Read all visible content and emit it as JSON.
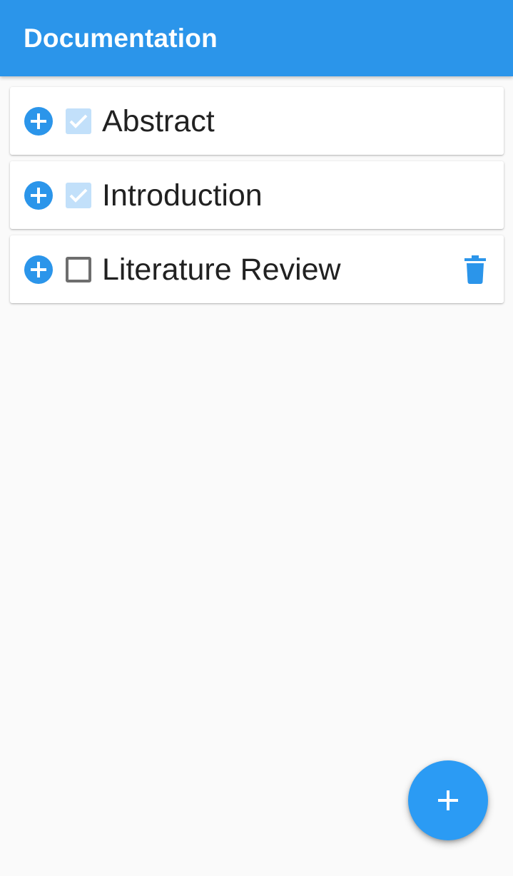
{
  "app_bar": {
    "title": "Documentation"
  },
  "sections": [
    {
      "label": "Abstract",
      "checked": true,
      "show_delete": false
    },
    {
      "label": "Introduction",
      "checked": true,
      "show_delete": false
    },
    {
      "label": "Literature Review",
      "checked": false,
      "show_delete": true
    }
  ],
  "icons": {
    "add_subsection": "plus-circle-icon",
    "checkbox_checked": "checkbox-checked-icon",
    "checkbox_unchecked": "checkbox-unchecked-icon",
    "delete": "trash-icon",
    "fab": "plus-icon"
  },
  "colors": {
    "primary": "#2b95ea",
    "fab": "#2b9bf4",
    "checked_fill": "#c2e0fa",
    "text": "#212121",
    "background": "#fafafa"
  }
}
